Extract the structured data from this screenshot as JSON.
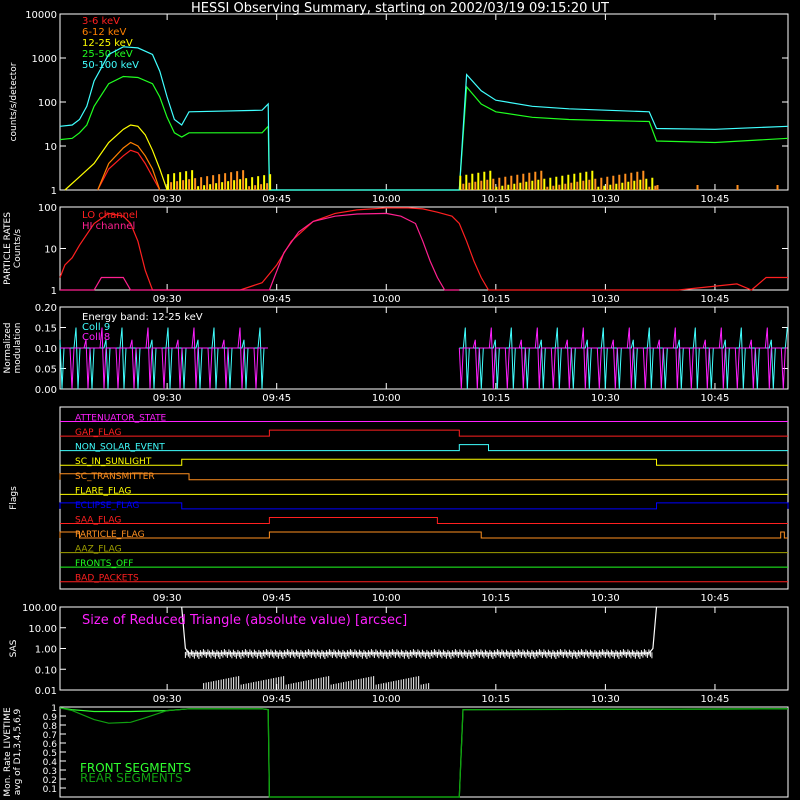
{
  "title": "HESSI Observing Summary, starting on 2002/03/19 09:15:20 UT",
  "time_ticks": [
    "09:30",
    "09:45",
    "10:00",
    "10:15",
    "10:30",
    "10:45"
  ],
  "colors": {
    "e3_6": "#ff2020",
    "e6_12": "#ff8000",
    "e12_25": "#ffff00",
    "e25_50": "#20ff20",
    "e50_100": "#40ffff",
    "magenta": "#ff20ff",
    "blue": "#0000ff",
    "orange": "#ff9020",
    "olive": "#a0a000",
    "front": "#30ff30",
    "rear": "#10a010"
  },
  "chart_data": [
    {
      "type": "line",
      "panel": "count-rates",
      "ylabel": "counts/s/detector",
      "yscale": "log",
      "ylim": [
        1,
        10000
      ],
      "y_ticks": [
        "1",
        "10",
        "100",
        "1000",
        "10000"
      ],
      "xlim": [
        "09:15:20",
        "10:55:00"
      ],
      "series": [
        {
          "name": "3-6 keV",
          "color": "#ff2020",
          "x": [
            "09:20:30",
            "09:22",
            "09:24",
            "09:25",
            "09:26",
            "09:27",
            "09:28",
            "09:29"
          ],
          "y": [
            1,
            3,
            6,
            8,
            7,
            4,
            2,
            1
          ]
        },
        {
          "name": "6-12 keV",
          "color": "#ff8000",
          "x": [
            "09:20:30",
            "09:22",
            "09:24",
            "09:25",
            "09:26",
            "09:27",
            "09:28",
            "09:29"
          ],
          "y": [
            1,
            4,
            9,
            12,
            10,
            6,
            3,
            1
          ]
        },
        {
          "name": "12-25 keV",
          "color": "#ffff00",
          "x": [
            "09:16",
            "09:18",
            "09:20",
            "09:22",
            "09:24",
            "09:25",
            "09:26",
            "09:27",
            "09:28",
            "09:29",
            "09:30"
          ],
          "y": [
            1,
            2,
            4,
            12,
            24,
            30,
            28,
            18,
            8,
            3,
            1
          ]
        },
        {
          "name": "25-50 keV",
          "color": "#20ff20",
          "x": [
            "09:15:20",
            "09:17",
            "09:18",
            "09:19",
            "09:20",
            "09:22",
            "09:24",
            "09:26",
            "09:28",
            "09:29",
            "09:30",
            "09:31",
            "09:32",
            "09:33",
            "09:43",
            "09:43:50",
            "09:44",
            "10:10",
            "10:11",
            "10:13",
            "10:15",
            "10:20",
            "10:25",
            "10:30",
            "10:36",
            "10:37",
            "10:45",
            "10:55"
          ],
          "y": [
            14,
            15,
            20,
            30,
            80,
            260,
            380,
            360,
            260,
            130,
            45,
            20,
            16,
            20,
            20,
            28,
            1,
            1,
            220,
            90,
            60,
            45,
            40,
            38,
            36,
            13,
            12,
            15
          ]
        },
        {
          "name": "50-100 keV",
          "color": "#40ffff",
          "x": [
            "09:15:20",
            "09:17",
            "09:18",
            "09:19",
            "09:20",
            "09:22",
            "09:24",
            "09:26",
            "09:28",
            "09:29",
            "09:30",
            "09:31",
            "09:32",
            "09:33",
            "09:43",
            "09:43:50",
            "09:44",
            "10:10",
            "10:11",
            "10:13",
            "10:15",
            "10:20",
            "10:25",
            "10:30",
            "10:36",
            "10:37",
            "10:45",
            "10:55"
          ],
          "y": [
            28,
            30,
            40,
            80,
            300,
            1200,
            1800,
            1700,
            1200,
            500,
            130,
            40,
            30,
            60,
            65,
            90,
            1,
            1,
            420,
            180,
            110,
            80,
            70,
            65,
            60,
            25,
            24,
            28
          ]
        }
      ]
    },
    {
      "type": "line",
      "panel": "particle-rates",
      "ylabel": "PARTICLE RATES Counts/s",
      "yscale": "log",
      "ylim": [
        1,
        100
      ],
      "y_ticks": [
        "1",
        "10",
        "100"
      ],
      "series": [
        {
          "name": "LO channel",
          "color": "#ff2020",
          "x": [
            "09:15:20",
            "09:16",
            "09:17",
            "09:18",
            "09:20",
            "09:22",
            "09:24",
            "09:25",
            "09:26",
            "09:27",
            "09:28",
            "09:30",
            "09:40",
            "09:43",
            "09:45",
            "09:47",
            "09:50",
            "09:53",
            "09:56",
            "10:00",
            "10:03",
            "10:05",
            "10:07",
            "10:09",
            "10:10",
            "10:11",
            "10:12",
            "10:13",
            "10:14",
            "10:30",
            "10:40",
            "10:48",
            "10:50",
            "10:52",
            "10:55"
          ],
          "y": [
            2,
            4,
            6,
            12,
            40,
            70,
            60,
            40,
            15,
            3,
            1,
            1,
            1,
            1.5,
            4,
            15,
            45,
            70,
            85,
            95,
            95,
            90,
            75,
            60,
            40,
            15,
            5,
            2,
            1,
            1,
            1,
            1.4,
            1,
            2,
            2
          ]
        },
        {
          "name": "HI channel",
          "color": "#ff2090",
          "x": [
            "09:15:20",
            "09:20",
            "09:21",
            "09:22",
            "09:24",
            "09:25",
            "09:30",
            "09:44",
            "09:46",
            "09:48",
            "09:50",
            "09:53",
            "09:56",
            "10:00",
            "10:02",
            "10:04",
            "10:05",
            "10:06",
            "10:07",
            "10:08",
            "10:10"
          ],
          "y": [
            1,
            1,
            2,
            2,
            2,
            1,
            1,
            1,
            8,
            25,
            45,
            60,
            68,
            70,
            60,
            40,
            15,
            5,
            2,
            1,
            1
          ]
        }
      ]
    },
    {
      "type": "line",
      "panel": "modulation",
      "ylabel": "Normalized modulation",
      "ylim": [
        0,
        0.2
      ],
      "y_ticks": [
        "0.00",
        "0.05",
        "0.10",
        "0.15",
        "0.20"
      ],
      "legend": [
        "Energy band: 12-25 keV",
        "Coll 9",
        "Coll 8"
      ],
      "series": [
        {
          "name": "Coll 9",
          "color": "#40ffff",
          "typical": 0.1,
          "active_ranges": [
            [
              "09:15:20",
              "09:43:50"
            ],
            [
              "10:10",
              "10:55"
            ]
          ]
        },
        {
          "name": "Coll 8",
          "color": "#ff20ff",
          "typical": 0.1,
          "active_ranges": [
            [
              "09:15:20",
              "09:43:50"
            ],
            [
              "10:10",
              "10:55"
            ]
          ]
        }
      ]
    },
    {
      "type": "timeline",
      "panel": "flags",
      "ylabel": "Flags",
      "flags": [
        {
          "label": "ATTENUATOR_STATE",
          "color": "#ff20ff",
          "on": []
        },
        {
          "label": "GAP_FLAG",
          "color": "#ff2020",
          "on": [
            [
              "09:44",
              "10:10"
            ]
          ]
        },
        {
          "label": "NON_SOLAR_EVENT",
          "color": "#40ffff",
          "on": [
            [
              "10:10",
              "10:14"
            ]
          ]
        },
        {
          "label": "SC_IN_SUNLIGHT",
          "color": "#ffff00",
          "on": [
            [
              "09:32",
              "10:37"
            ]
          ]
        },
        {
          "label": "SC_TRANSMITTER",
          "color": "#ff9020",
          "on": [
            [
              "09:15:20",
              "09:33"
            ]
          ]
        },
        {
          "label": "FLARE_FLAG",
          "color": "#ffff00",
          "on": []
        },
        {
          "label": "ECLIPSE_FLAG",
          "color": "#0000ff",
          "on": [
            [
              "09:15:20",
              "09:32"
            ],
            [
              "10:37",
              "10:55"
            ]
          ]
        },
        {
          "label": "SAA_FLAG",
          "color": "#ff2020",
          "on": [
            [
              "09:44",
              "10:07"
            ]
          ]
        },
        {
          "label": "PARTICLE_FLAG",
          "color": "#ff9020",
          "on": [
            [
              "09:15:20",
              "09:18"
            ],
            [
              "09:44",
              "10:13"
            ],
            [
              "10:54",
              "10:54:30"
            ]
          ]
        },
        {
          "label": "AAZ_FLAG",
          "color": "#a0a000",
          "on": []
        },
        {
          "label": "FRONTS_OFF",
          "color": "#20ff20",
          "on": []
        },
        {
          "label": "BAD_PACKETS",
          "color": "#ff2020",
          "on": []
        }
      ]
    },
    {
      "type": "line",
      "panel": "sas",
      "ylabel": "SAS",
      "title": "Size of Reduced Triangle (absolute value) [arcsec]",
      "yscale": "log",
      "ylim": [
        0.01,
        100
      ],
      "y_ticks": [
        "0.01",
        "1.00",
        "0.10",
        "10.00",
        "100.00"
      ],
      "series": [
        {
          "name": "",
          "color": "#ffffff",
          "x": [
            "09:32",
            "09:32:30",
            "09:33",
            "10:36",
            "10:36:30",
            "10:37"
          ],
          "y": [
            100,
            1.0,
            0.6,
            0.6,
            1.0,
            100
          ]
        }
      ]
    },
    {
      "type": "line",
      "panel": "livetime",
      "ylabel": "Mon. Rate LIVETIME avg of D1,3,4,5,6,9",
      "ylim": [
        0,
        1.0
      ],
      "y_ticks": [
        "0",
        "0.1",
        "0.2",
        "0.3",
        "0.4",
        "0.5",
        "0.6",
        "0.7",
        "0.8",
        "0.9",
        "1"
      ],
      "series": [
        {
          "name": "FRONT SEGMENTS",
          "color": "#30ff30",
          "x": [
            "09:15:20",
            "09:17",
            "09:20",
            "09:25",
            "09:30",
            "09:33",
            "09:43",
            "09:43:50",
            "09:44",
            "10:10",
            "10:10:30",
            "10:55"
          ],
          "y": [
            0.99,
            0.97,
            0.95,
            0.95,
            0.96,
            0.98,
            0.98,
            0.97,
            0.0,
            0.0,
            0.97,
            0.98
          ]
        },
        {
          "name": "REAR SEGMENTS",
          "color": "#10a010",
          "x": [
            "09:15:20",
            "09:17",
            "09:20",
            "09:22",
            "09:25",
            "09:27",
            "09:30",
            "09:33",
            "09:43",
            "09:43:50",
            "09:44",
            "10:10",
            "10:10:30",
            "10:55"
          ],
          "y": [
            0.99,
            0.96,
            0.86,
            0.82,
            0.83,
            0.88,
            0.96,
            0.98,
            0.98,
            0.97,
            0.0,
            0.0,
            0.97,
            0.98
          ]
        }
      ]
    }
  ]
}
